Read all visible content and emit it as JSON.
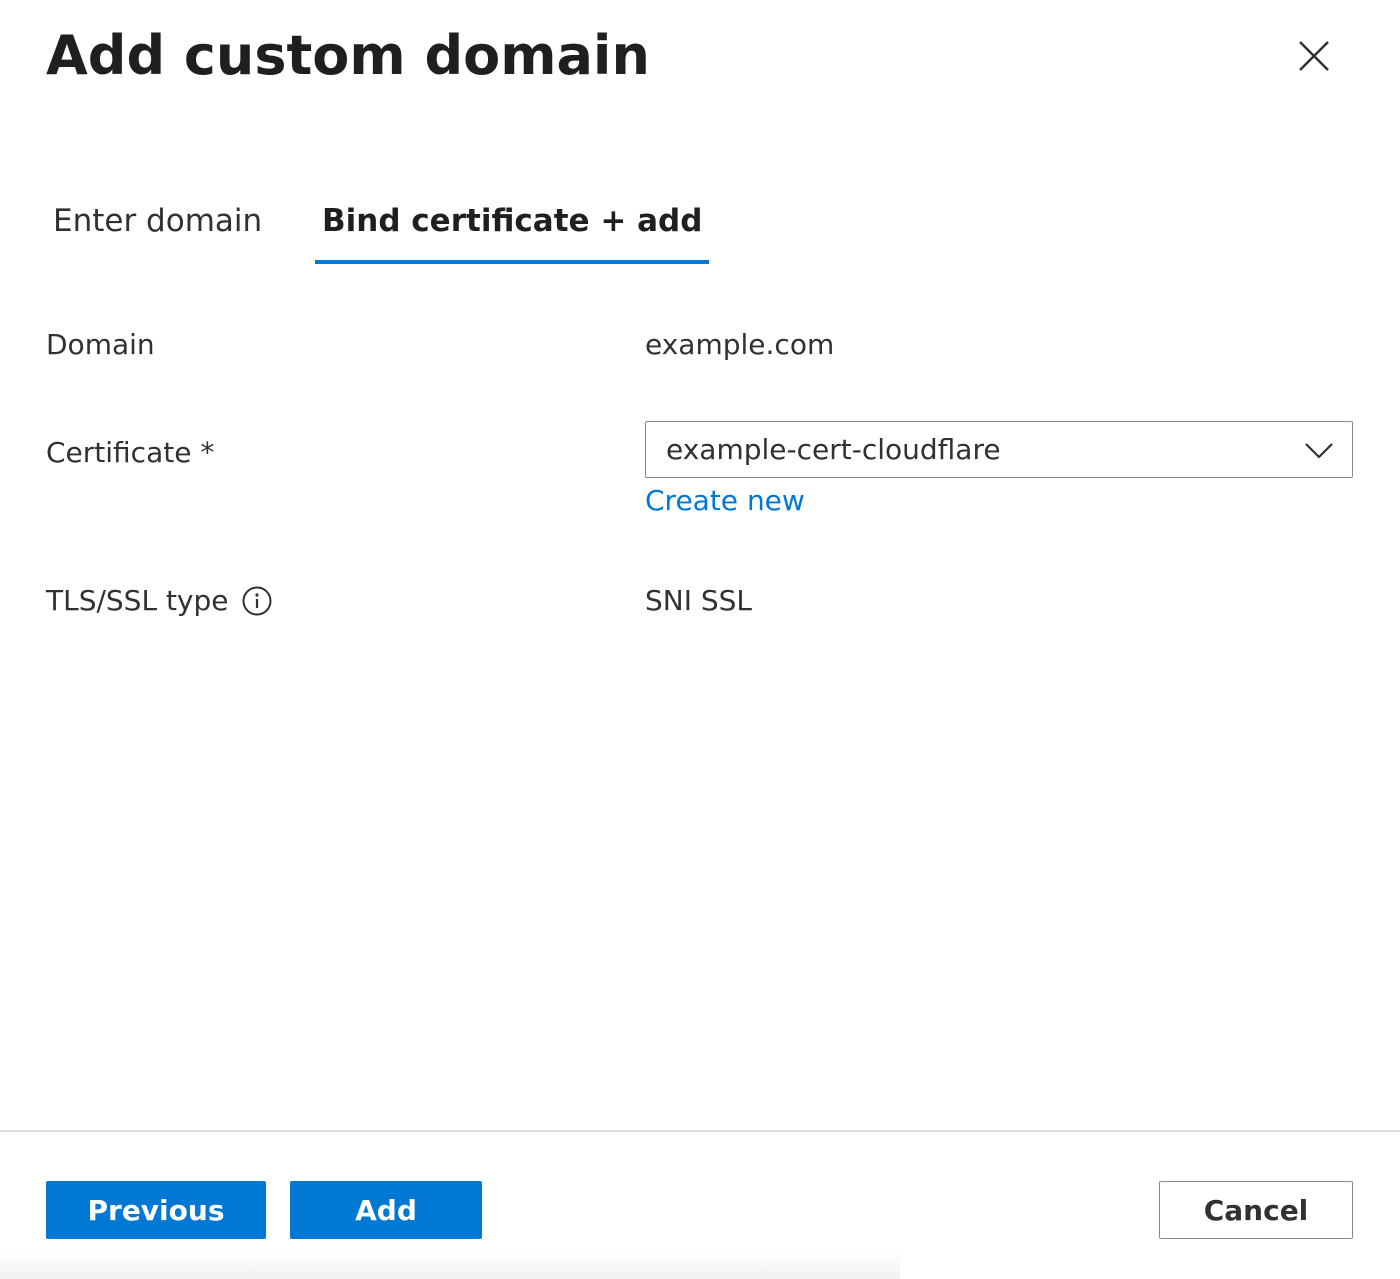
{
  "dialog": {
    "title": "Add custom domain",
    "close_icon": "close-icon"
  },
  "tabs": [
    {
      "label": "Enter domain",
      "selected": false
    },
    {
      "label": "Bind certificate + add",
      "selected": true
    }
  ],
  "form": {
    "domain": {
      "label": "Domain",
      "value": "example.com"
    },
    "certificate": {
      "label": "Certificate *",
      "selected_value": "example-cert-cloudflare",
      "create_new_link": "Create new"
    },
    "tls_ssl_type": {
      "label": "TLS/SSL type",
      "info_icon": "info-icon",
      "value": "SNI SSL"
    }
  },
  "footer": {
    "previous_label": "Previous",
    "add_label": "Add",
    "cancel_label": "Cancel"
  },
  "colors": {
    "accent": "#0078d4",
    "text": "#323130",
    "border": "#8a8886"
  }
}
